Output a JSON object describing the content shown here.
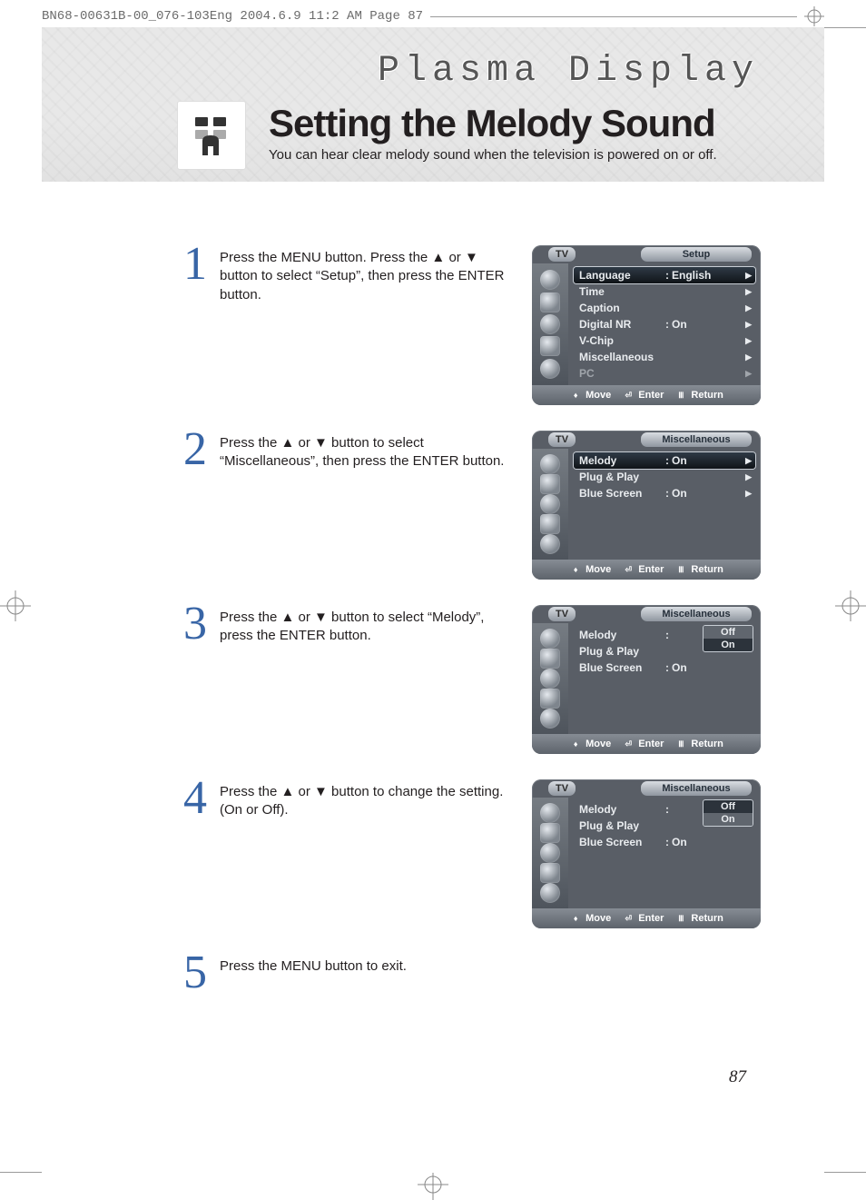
{
  "print_header": "BN68-00631B-00_076-103Eng  2004.6.9  11:2 AM  Page 87",
  "hero": {
    "brand": "Plasma Display",
    "title": "Setting the Melody Sound",
    "subtitle": "You can hear clear melody sound when the television is powered on or off."
  },
  "steps": [
    {
      "num": "1",
      "text": "Press the MENU button. Press the ▲ or ▼ button to select “Setup”, then press the ENTER button."
    },
    {
      "num": "2",
      "text": "Press the ▲ or ▼ button to select “Miscellaneous”, then press the ENTER button."
    },
    {
      "num": "3",
      "text": "Press the ▲ or ▼ button to select “Melody”, press the ENTER button."
    },
    {
      "num": "4",
      "text": "Press the ▲ or ▼ button to change the setting. (On or Off)."
    },
    {
      "num": "5",
      "text": "Press the MENU button to exit."
    }
  ],
  "osd_footer": {
    "move": "Move",
    "enter": "Enter",
    "return": "Return"
  },
  "osd1": {
    "tv": "TV",
    "title": "Setup",
    "rows": [
      {
        "label": "Language",
        "colon": ":",
        "value": "English",
        "arrow": "▶",
        "sel": true
      },
      {
        "label": "Time",
        "colon": "",
        "value": "",
        "arrow": "▶"
      },
      {
        "label": "Caption",
        "colon": "",
        "value": "",
        "arrow": "▶"
      },
      {
        "label": "Digital NR",
        "colon": ":",
        "value": "On",
        "arrow": "▶"
      },
      {
        "label": "V-Chip",
        "colon": "",
        "value": "",
        "arrow": "▶"
      },
      {
        "label": "Miscellaneous",
        "colon": "",
        "value": "",
        "arrow": "▶"
      },
      {
        "label": "PC",
        "colon": "",
        "value": "",
        "arrow": "▶",
        "dim": true
      }
    ]
  },
  "osd2": {
    "tv": "TV",
    "title": "Miscellaneous",
    "rows": [
      {
        "label": "Melody",
        "colon": ":",
        "value": "On",
        "arrow": "▶",
        "sel": true
      },
      {
        "label": "Plug & Play",
        "colon": "",
        "value": "",
        "arrow": "▶"
      },
      {
        "label": "Blue Screen",
        "colon": ":",
        "value": "On",
        "arrow": "▶"
      }
    ]
  },
  "osd3": {
    "tv": "TV",
    "title": "Miscellaneous",
    "rows": [
      {
        "label": "Melody",
        "colon": ":",
        "value": ""
      },
      {
        "label": "Plug & Play",
        "colon": "",
        "value": ""
      },
      {
        "label": "Blue Screen",
        "colon": ":",
        "value": "On"
      }
    ],
    "popup": {
      "options": [
        "Off",
        "On"
      ],
      "selected": "Off"
    }
  },
  "osd4": {
    "tv": "TV",
    "title": "Miscellaneous",
    "rows": [
      {
        "label": "Melody",
        "colon": ":",
        "value": ""
      },
      {
        "label": "Plug & Play",
        "colon": "",
        "value": ""
      },
      {
        "label": "Blue Screen",
        "colon": ":",
        "value": "On"
      }
    ],
    "popup": {
      "options": [
        "Off",
        "On"
      ],
      "selected": "On"
    }
  },
  "page_number": "87"
}
